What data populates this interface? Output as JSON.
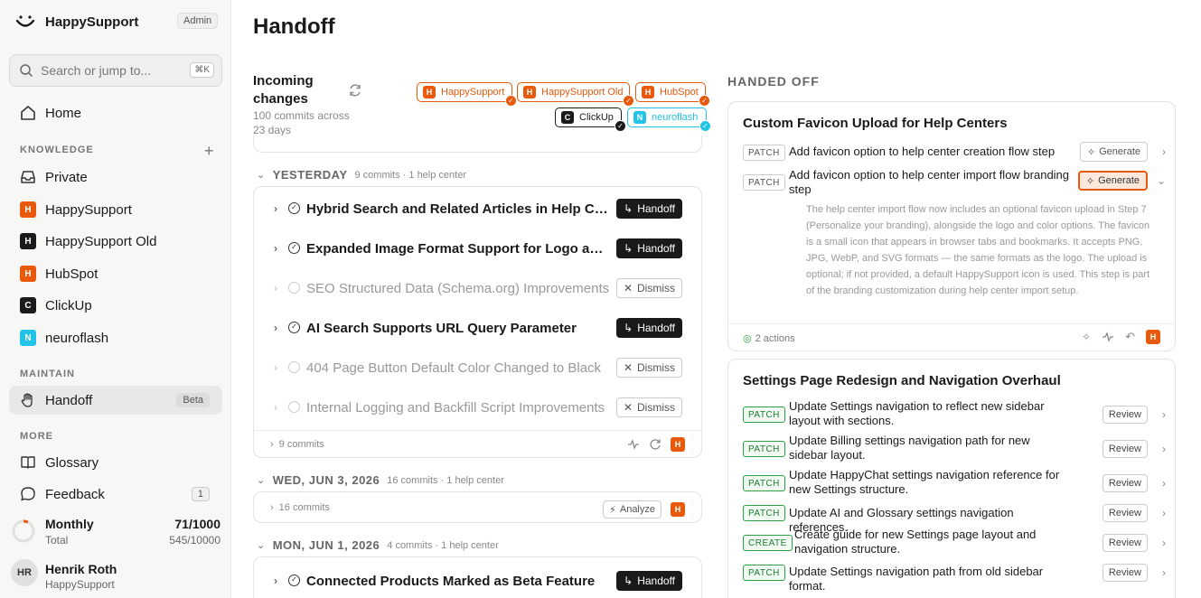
{
  "brand": {
    "name": "HappySupport",
    "admin": "Admin"
  },
  "search": {
    "placeholder": "Search or jump to...",
    "shortcut": "⌘K"
  },
  "nav": {
    "home": "Home",
    "knowledge_label": "KNOWLEDGE",
    "knowledge": [
      {
        "label": "Private",
        "icon": "inbox-icon"
      },
      {
        "label": "HappySupport",
        "letter": "H",
        "color": "#e8590c"
      },
      {
        "label": "HappySupport Old",
        "letter": "H",
        "color": "#1a1a1a"
      },
      {
        "label": "HubSpot",
        "letter": "H",
        "color": "#e8590c"
      },
      {
        "label": "ClickUp",
        "letter": "C",
        "color": "#1a1a1a"
      },
      {
        "label": "neuroflash",
        "letter": "N",
        "color": "#22c3e6"
      }
    ],
    "maintain_label": "MAINTAIN",
    "handoff": "Handoff",
    "beta": "Beta",
    "more_label": "MORE",
    "glossary": "Glossary",
    "feedback": "Feedback",
    "feedback_count": "1"
  },
  "usage": {
    "title": "Monthly",
    "sub": "Total",
    "value": "71/1000",
    "total": "545/10000",
    "fraction": 0.071
  },
  "user": {
    "initials": "HR",
    "name": "Henrik Roth",
    "org": "HappySupport"
  },
  "page": {
    "title": "Handoff"
  },
  "incoming": {
    "title": "Incoming changes",
    "sub": "100 commits across 23 days",
    "chips": [
      {
        "label": "HappySupport",
        "letter": "H",
        "color": "#e8590c",
        "check": "#e8590c"
      },
      {
        "label": "HappySupport Old",
        "letter": "H",
        "color": "#e8590c",
        "check": "#e8590c"
      },
      {
        "label": "HubSpot",
        "letter": "H",
        "color": "#e8590c",
        "check": "#e8590c"
      },
      {
        "label": "ClickUp",
        "letter": "C",
        "color": "#1a1a1a",
        "check": "#1a1a1a"
      },
      {
        "label": "neuroflash",
        "letter": "N",
        "color": "#22c3e6",
        "check": "#22c3e6"
      }
    ]
  },
  "yesterday": {
    "label": "YESTERDAY",
    "meta": "9 commits · 1 help center",
    "rows": [
      {
        "title": "Hybrid Search and Related Articles in Help Center",
        "action": "Handoff",
        "dim": false
      },
      {
        "title": "Expanded Image Format Support for Logo and Favicon",
        "action": "Handoff",
        "dim": false
      },
      {
        "title": "SEO Structured Data (Schema.org) Improvements",
        "action": "Dismiss",
        "dim": true
      },
      {
        "title": "AI Search Supports URL Query Parameter",
        "action": "Handoff",
        "dim": false
      },
      {
        "title": "404 Page Button Default Color Changed to Black",
        "action": "Dismiss",
        "dim": true
      },
      {
        "title": "Internal Logging and Backfill Script Improvements",
        "action": "Dismiss",
        "dim": true
      }
    ],
    "footer": "9 commits"
  },
  "jun3": {
    "label": "WED, JUN 3, 2026",
    "meta": "16 commits · 1 help center",
    "footer": "16 commits",
    "analyze": "Analyze"
  },
  "jun1": {
    "label": "MON, JUN 1, 2026",
    "meta": "4 commits · 1 help center",
    "row": "Connected Products Marked as Beta Feature",
    "action": "Handoff"
  },
  "handed_off": {
    "label": "HANDED OFF",
    "card1": {
      "title": "Custom Favicon Upload for Help Centers",
      "items": [
        {
          "tag": "PATCH",
          "text": "Add favicon option to help center creation flow step",
          "button": "Generate"
        },
        {
          "tag": "PATCH",
          "text": "Add favicon option to help center import flow branding step",
          "button": "Generate"
        }
      ],
      "description": "The help center import flow now includes an optional favicon upload in Step 7 (Personalize your branding), alongside the logo and color options. The favicon is a small icon that appears in browser tabs and bookmarks. It accepts PNG, JPG, WebP, and SVG formats — the same formats as the logo. The upload is optional; if not provided, a default HappySupport icon is used. This step is part of the branding customization during help center import setup.",
      "actions": "2 actions"
    },
    "card2": {
      "title": "Settings Page Redesign and Navigation Overhaul",
      "items": [
        {
          "tag": "PATCH",
          "text": "Update Settings navigation to reflect new sidebar layout with sections.",
          "button": "Review"
        },
        {
          "tag": "PATCH",
          "text": "Update Billing settings navigation path for new sidebar layout.",
          "button": "Review"
        },
        {
          "tag": "PATCH",
          "text": "Update HappyChat settings navigation reference for new Settings structure.",
          "button": "Review"
        },
        {
          "tag": "PATCH",
          "text": "Update AI and Glossary settings navigation references.",
          "button": "Review"
        },
        {
          "tag": "CREATE",
          "text": "Create guide for new Settings page layout and navigation structure.",
          "button": "Review"
        },
        {
          "tag": "PATCH",
          "text": "Update Settings navigation path from old sidebar format.",
          "button": "Review"
        }
      ]
    }
  }
}
